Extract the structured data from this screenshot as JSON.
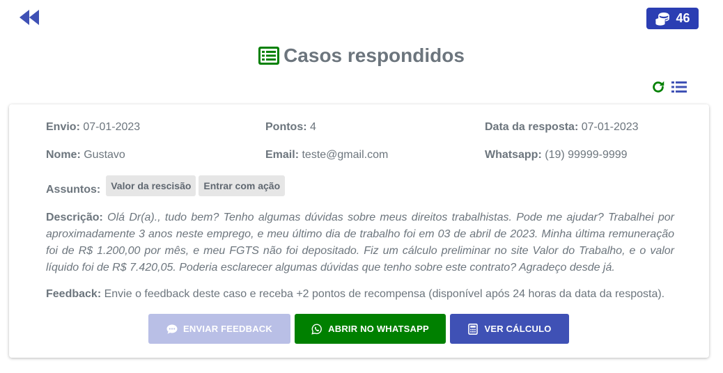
{
  "header": {
    "coins": "46",
    "title": "Casos respondidos"
  },
  "colors": {
    "primary": "#3f51b5",
    "badge": "#2b3eb3",
    "success": "#008000",
    "disabled": "#b9bfe6",
    "text": "#6c757d"
  },
  "icons": {
    "back": "fast-backward-icon",
    "coins": "coins-icon",
    "title": "list-alt-icon",
    "refresh": "refresh-icon",
    "list": "list-icon",
    "feedback": "comment-dots-icon",
    "whatsapp": "whatsapp-icon",
    "calc": "calculator-icon"
  },
  "case": {
    "envio_label": "Envio:",
    "envio": "07-01-2023",
    "pontos_label": "Pontos:",
    "pontos": "4",
    "data_resposta_label": "Data da resposta:",
    "data_resposta": "07-01-2023",
    "nome_label": "Nome:",
    "nome": "Gustavo",
    "email_label": "Email:",
    "email": "teste@gmail.com",
    "whatsapp_label": "Whatsapp:",
    "whatsapp": "(19) 99999-9999",
    "assuntos_label": "Assuntos:",
    "assuntos": [
      "Valor da rescisão",
      "Entrar com ação"
    ],
    "descricao_label": "Descrição:",
    "descricao": "Olá Dr(a)., tudo bem? Tenho algumas dúvidas sobre meus direitos trabalhistas. Pode me ajudar? Trabalhei por aproximadamente 3 anos neste emprego, e meu último dia de trabalho foi em 03 de abril de 2023. Minha última remuneração foi de R$ 1.200,00 por mês, e meu FGTS não foi depositado. Fiz um cálculo preliminar no site Valor do Trabalho, e o valor líquido foi de R$ 7.420,05. Poderia esclarecer algumas dúvidas que tenho sobre este contrato? Agradeço desde já.",
    "feedback_label": "Feedback:",
    "feedback": "Envie o feedback deste caso e receba +2 pontos de recompensa (disponível após 24 horas da data da resposta)."
  },
  "actions": {
    "feedback_label": "ENVIAR FEEDBACK",
    "whatsapp_label": "ABRIR NO WHATSAPP",
    "calc_label": "VER CÁLCULO"
  }
}
